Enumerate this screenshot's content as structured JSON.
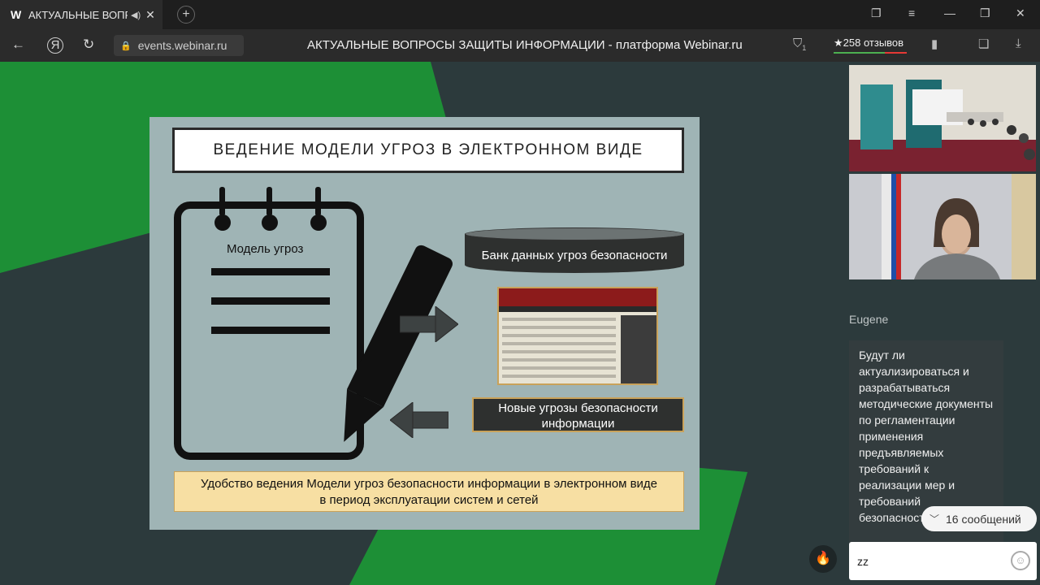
{
  "browser": {
    "tab_favicon": "W",
    "tab_title": "АКТУАЛЬНЫЕ ВОПРО",
    "url": "events.webinar.ru",
    "page_title": "АКТУАЛЬНЫЕ ВОПРОСЫ ЗАЩИТЫ ИНФОРМАЦИИ - платформа Webinar.ru",
    "reviews": "258 отзывов",
    "shield_count": "1",
    "icons": [
      "speaker-icon",
      "close-icon",
      "plus-icon",
      "bookmarks-icon",
      "menu-icon",
      "minimize-icon",
      "maximize-icon",
      "close-window-icon",
      "back-icon",
      "yandex-icon",
      "reload-icon",
      "lock-icon",
      "shield-icon",
      "star-icon",
      "bookmark-icon",
      "chat-icon",
      "download-icon"
    ]
  },
  "slide": {
    "title": "ВЕДЕНИЕ МОДЕЛИ УГРОЗ  В ЭЛЕКТРОННОМ ВИДЕ",
    "pad_label": "Модель угроз",
    "database_label": "Банк данных угроз безопасности",
    "new_threats_label": "Новые угрозы безопасности информации",
    "bottom_line1": "Удобство ведения Модели угроз безопасности информации в электронном виде",
    "bottom_line2": "в период эксплуатации систем и сетей"
  },
  "chat": {
    "author": "Eugene",
    "message": "Будут ли актуализироваться и разрабатываться методические документы по регламентации применения предъявляемых требований к реализации мер и требований безопасности",
    "unread_count": "16 сообщений",
    "input_value": "zz"
  },
  "colors": {
    "green": "#1d8f36",
    "background": "#2c3a3c",
    "slide": "#9fb4b5",
    "highlight": "#f7dfa3"
  }
}
